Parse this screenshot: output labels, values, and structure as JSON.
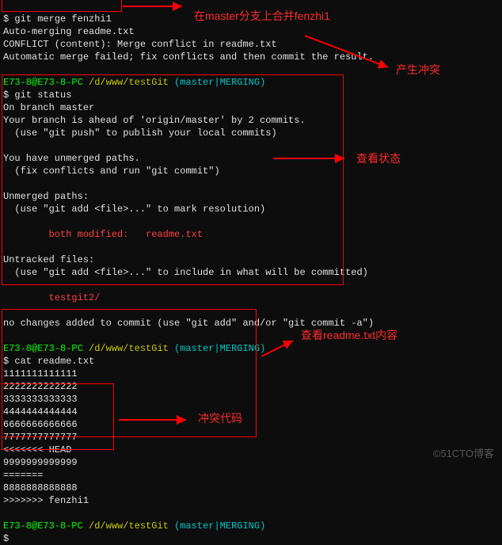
{
  "lines": {
    "l1_prompt": "$ ",
    "l1_cmd": "git merge fenzhi1",
    "l2": "Auto-merging readme.txt",
    "l3": "CONFLICT (content): Merge conflict in readme.txt",
    "l4": "Automatic merge failed; fix conflicts and then commit the result.",
    "l5": "",
    "ps_user": "E73-8@E73-8-PC ",
    "ps_path": "/d/www/testGit ",
    "ps_branch": "(master|MERGING)",
    "l7_prompt": "$ ",
    "l7_cmd": "git status",
    "l8": "On branch master",
    "l9": "Your branch is ahead of 'origin/master' by 2 commits.",
    "l10": "  (use \"git push\" to publish your local commits)",
    "l11": "",
    "l12": "You have unmerged paths.",
    "l13": "  (fix conflicts and run \"git commit\")",
    "l14": "",
    "l15": "Unmerged paths:",
    "l16": "  (use \"git add <file>...\" to mark resolution)",
    "l17": "",
    "l18": "        both modified:   readme.txt",
    "l19": "",
    "l20": "Untracked files:",
    "l21": "  (use \"git add <file>...\" to include in what will be committed)",
    "l22": "",
    "l23": "        testgit2/",
    "l24": "",
    "l25": "no changes added to commit (use \"git add\" and/or \"git commit -a\")",
    "l26": "",
    "l28_prompt": "$ ",
    "l28_cmd": "cat readme.txt",
    "l29": "1111111111111",
    "l30": "2222222222222",
    "l31": "3333333333333",
    "l32": "4444444444444",
    "l33": "6666666666666",
    "l34": "7777777777777",
    "l35": "<<<<<<< HEAD",
    "l36": "9999999999999",
    "l37": "=======",
    "l38": "8888888888888",
    "l39": ">>>>>>> fenzhi1",
    "l40": "",
    "l42_prompt": "$ "
  },
  "annotations": {
    "a1": "在master分支上合并fenzhi1",
    "a2": "产生冲突",
    "a3": "查看状态",
    "a4_pre": "查看",
    "a4_mid": "readme.txt",
    "a4_post": "内容",
    "a5": "冲突代码"
  },
  "watermark": "©51CTO博客"
}
